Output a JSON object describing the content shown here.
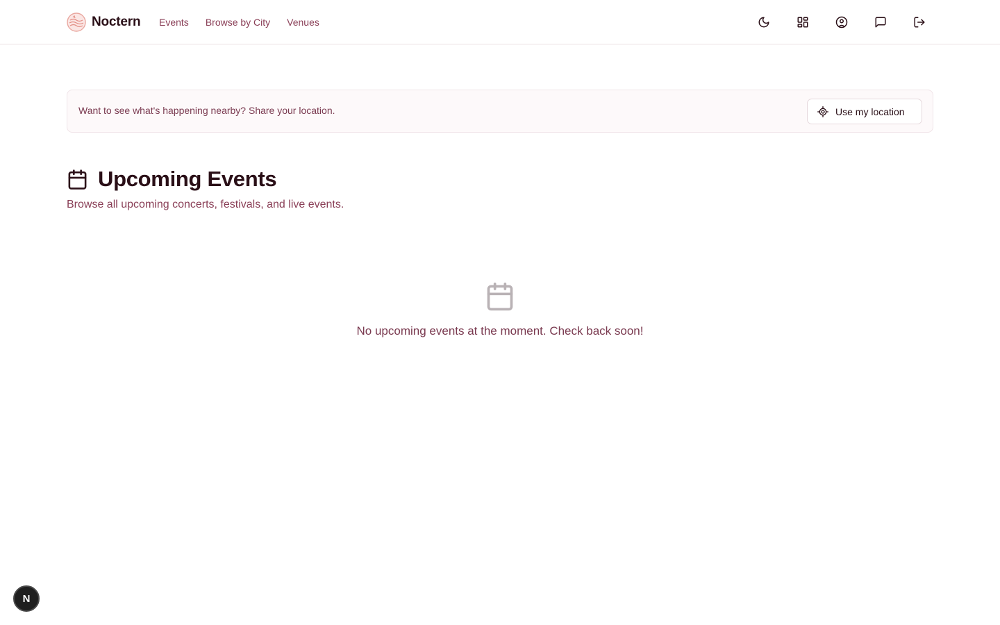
{
  "header": {
    "brand_name": "Noctern",
    "nav": [
      {
        "label": "Events"
      },
      {
        "label": "Browse by City"
      },
      {
        "label": "Venues"
      }
    ],
    "icons": [
      "moon-icon",
      "dashboard-icon",
      "user-circle-icon",
      "chat-icon",
      "logout-icon"
    ]
  },
  "location_banner": {
    "text": "Want to see what's happening nearby? Share your location.",
    "button_label": "Use my location"
  },
  "main": {
    "title": "Upcoming Events",
    "subtitle": "Browse all upcoming concerts, festivals, and live events.",
    "empty_message": "No upcoming events at the moment. Check back soon!"
  },
  "dev_badge": {
    "letter": "N"
  },
  "colors": {
    "text_dark": "#2a0f17",
    "text_accent": "#8a3f57",
    "border": "#ecdfe3",
    "empty_icon": "#b9b2b5"
  }
}
